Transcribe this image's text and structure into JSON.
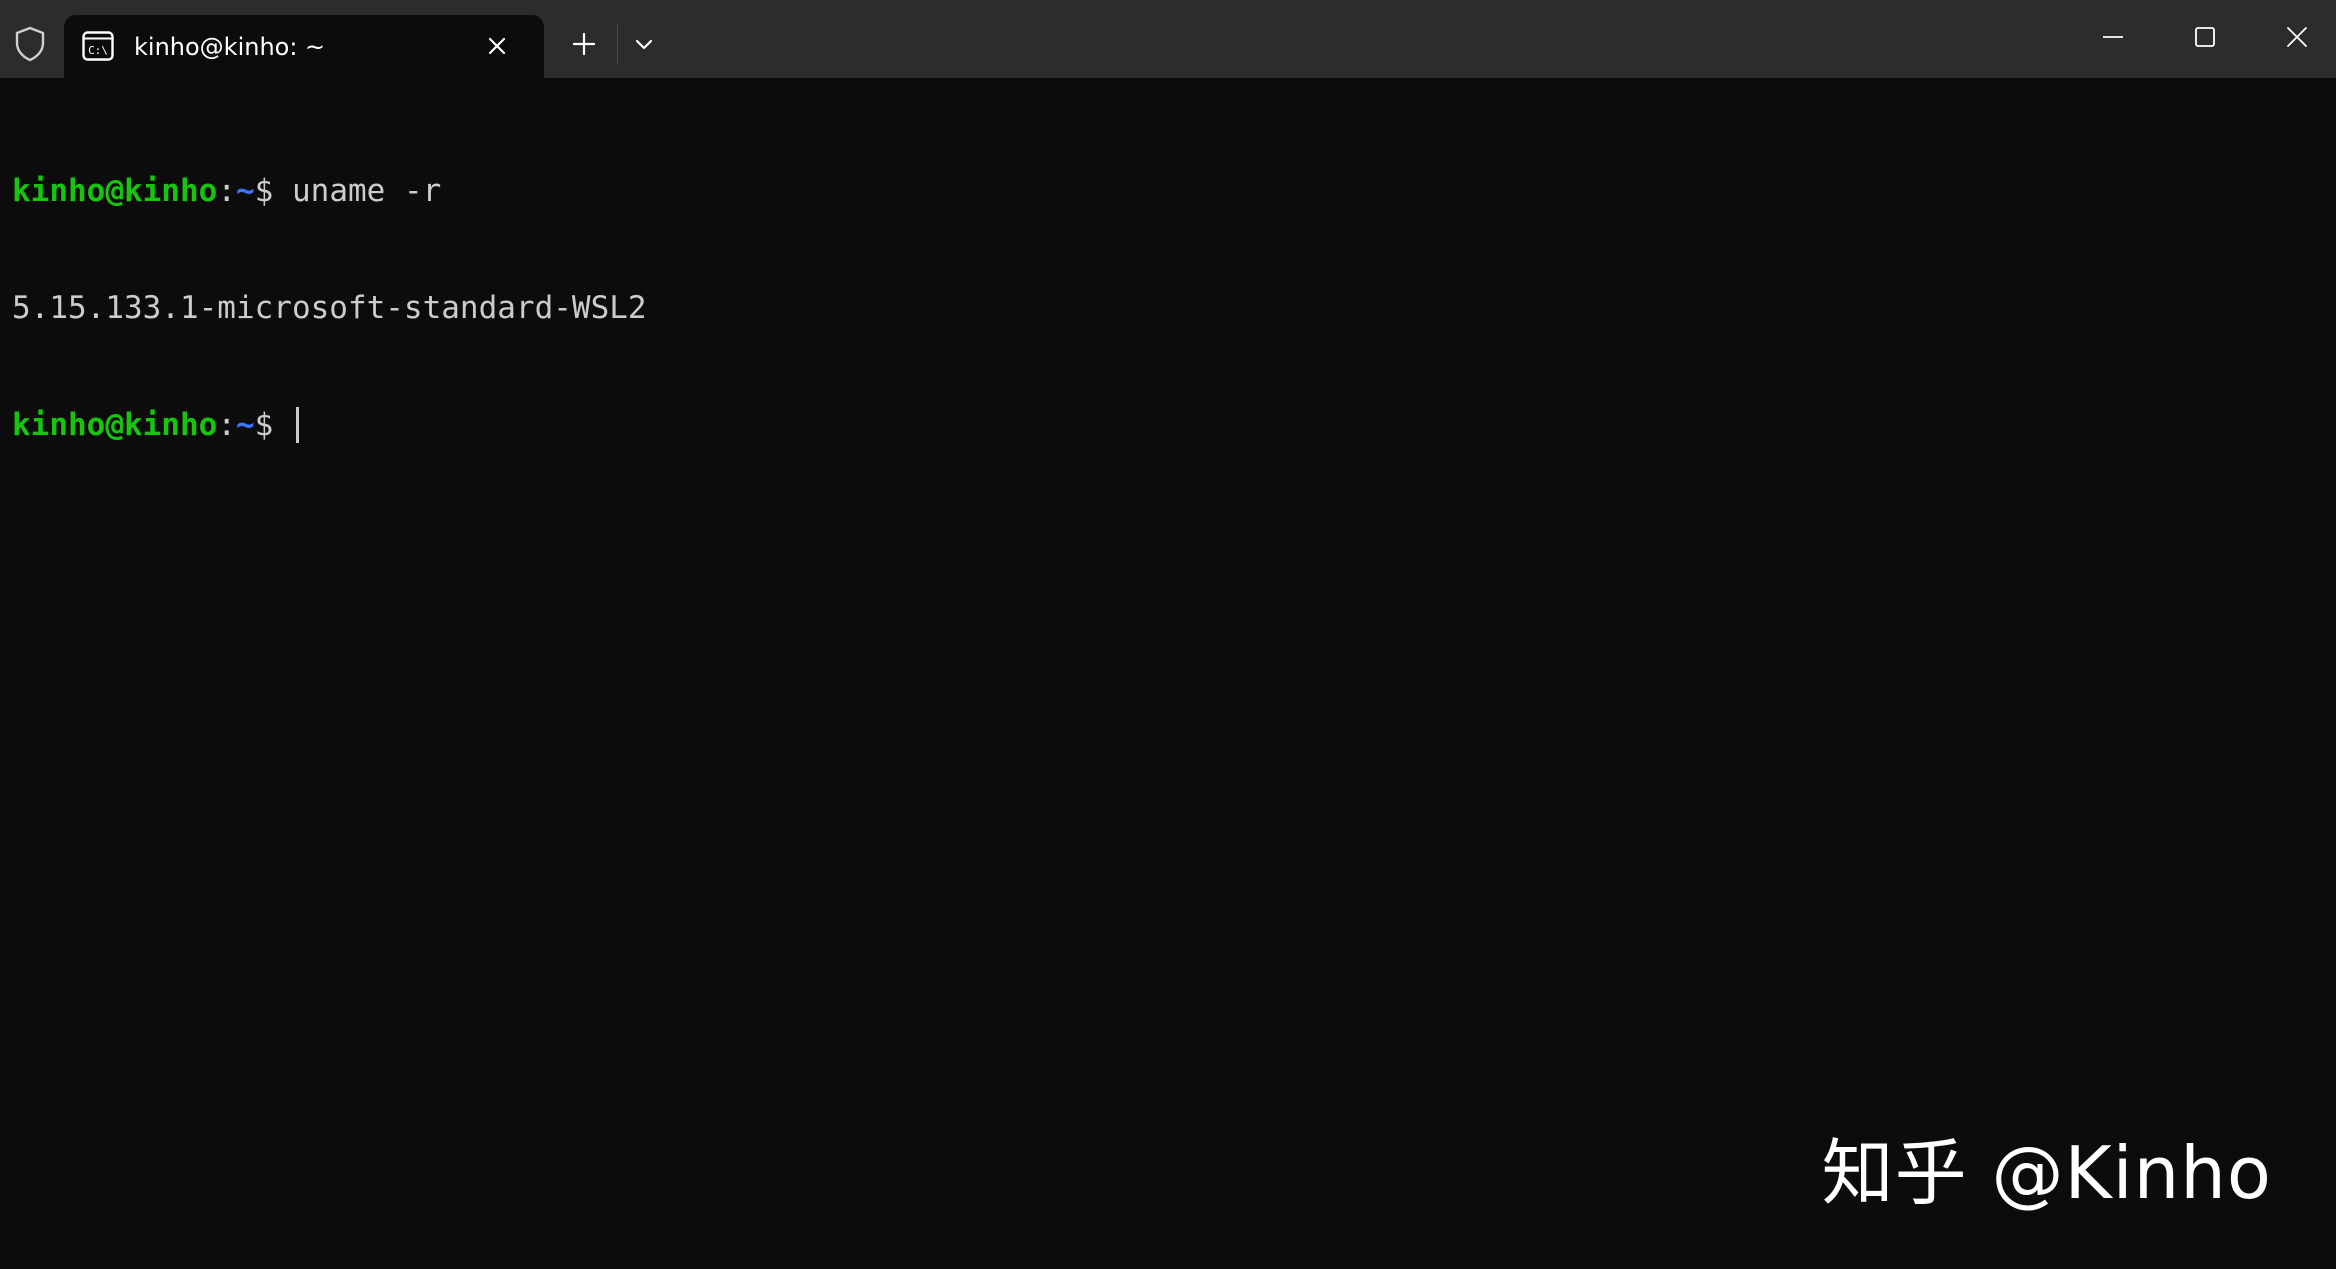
{
  "titlebar": {
    "shield_icon": "shield-icon",
    "tab": {
      "icon": "command-prompt-icon",
      "icon_text": "C:\\",
      "title": "kinho@kinho: ~",
      "close_icon": "close-icon"
    },
    "new_tab_icon": "plus-icon",
    "dropdown_icon": "chevron-down-icon",
    "window_controls": [
      "minimize-icon",
      "maximize-icon",
      "close-icon"
    ]
  },
  "terminal": {
    "lines": [
      {
        "prompt_user": "kinho@kinho",
        "prompt_sep": ":",
        "prompt_dir": "~",
        "prompt_symbol": "$",
        "command": " uname -r"
      },
      {
        "output": "5.15.133.1-microsoft-standard-WSL2"
      },
      {
        "prompt_user": "kinho@kinho",
        "prompt_sep": ":",
        "prompt_dir": "~",
        "prompt_symbol": "$",
        "command": " "
      }
    ]
  },
  "watermark": {
    "text": "知乎 @Kinho"
  },
  "colors": {
    "titlebar_bg": "#2c2c2c",
    "terminal_bg": "#0c0c0c",
    "prompt_user": "#16c60c",
    "prompt_dir": "#3b78ff",
    "text": "#cccccc"
  }
}
